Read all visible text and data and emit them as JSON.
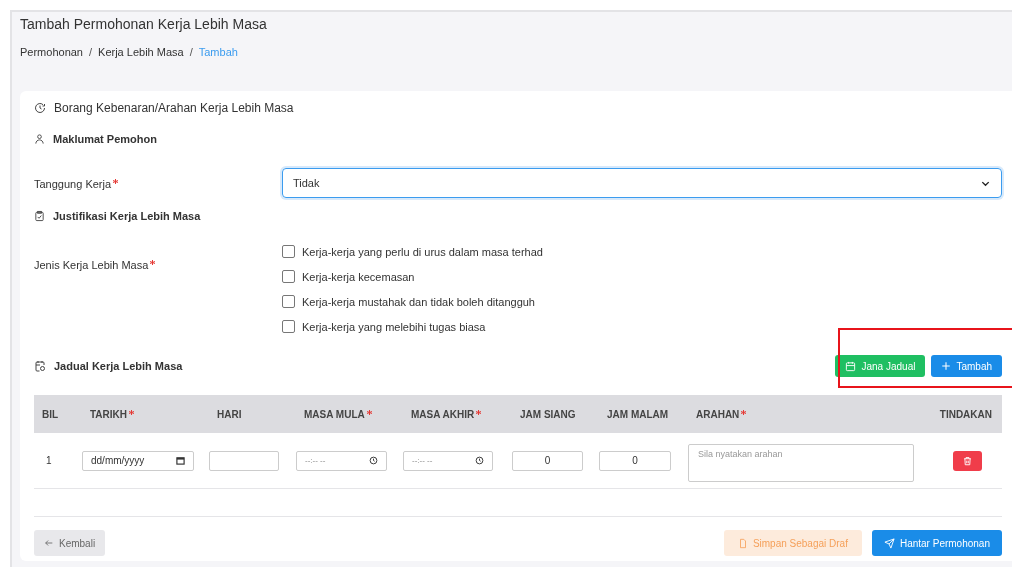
{
  "page": {
    "title": "Tambah Permohonan Kerja Lebih Masa"
  },
  "breadcrumb": [
    {
      "label": "Permohonan",
      "selected": false
    },
    {
      "label": "Kerja Lebih Masa",
      "selected": false
    },
    {
      "label": "Tambah",
      "selected": true
    }
  ],
  "breadcrumb_separator": "/",
  "form": {
    "title": "Borang Kebenaran/Arahan Kerja Lebih Masa",
    "applicant_section": {
      "title": "Maklumat Pemohon"
    },
    "responsibility": {
      "label": "Tanggung Kerja",
      "required": true,
      "value": "Tidak"
    },
    "justification_section": {
      "title": "Justifikasi Kerja Lebih Masa"
    },
    "work_type": {
      "label": "Jenis Kerja Lebih Masa",
      "required": true,
      "options": [
        {
          "label": "Kerja-kerja yang perlu di urus dalam masa terhad",
          "checked": false
        },
        {
          "label": "Kerja-kerja kecemasan",
          "checked": false
        },
        {
          "label": "Kerja-kerja mustahak dan tidak boleh ditangguh",
          "checked": false
        },
        {
          "label": "Kerja-kerja yang melebihi tugas biasa",
          "checked": false
        }
      ]
    },
    "schedule_section": {
      "title": "Jadual Kerja Lebih Masa",
      "highlighted": true,
      "buttons": [
        {
          "label": "Jana Jadual",
          "kind": "generate"
        },
        {
          "label": "Tambah",
          "kind": "add"
        }
      ]
    },
    "table": {
      "columns": [
        {
          "label": "BIL",
          "required": false
        },
        {
          "label": "TARIKH",
          "required": true
        },
        {
          "label": "HARI",
          "required": false
        },
        {
          "label": "MASA MULA",
          "required": true
        },
        {
          "label": "MASA AKHIR",
          "required": true
        },
        {
          "label": "JAM SIANG",
          "required": false
        },
        {
          "label": "JAM MALAM",
          "required": false
        },
        {
          "label": "ARAHAN",
          "required": true
        },
        {
          "label": "TINDAKAN",
          "required": false
        }
      ],
      "rows": [
        {
          "bil": "1",
          "date": {
            "placeholder": "dd/mm/yyyy"
          },
          "day": {},
          "start": {
            "placeholder": "--:-- --"
          },
          "end": {
            "placeholder": "--:-- --"
          },
          "day_hours": {
            "value": "0"
          },
          "night_hours": {
            "value": "0"
          },
          "instruction": {
            "placeholder": "Sila nyatakan arahan"
          }
        }
      ]
    },
    "footer": {
      "back": "Kembali",
      "draft": "Simpan Sebagai Draf",
      "submit": "Hantar Permohonan"
    }
  }
}
